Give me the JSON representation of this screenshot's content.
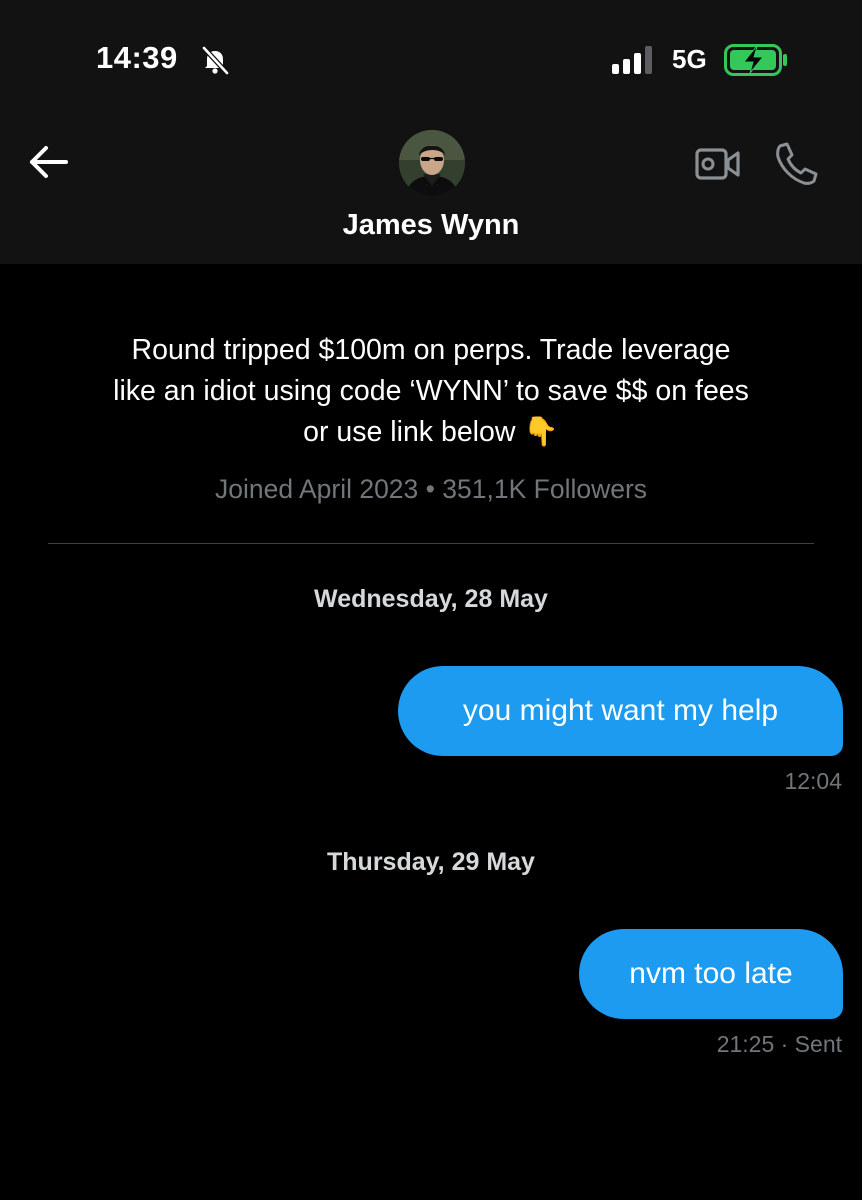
{
  "status_bar": {
    "time": "14:39",
    "network": "5G",
    "icons": [
      "bell-slash-icon",
      "signal-bars-icon",
      "battery-charging-icon"
    ]
  },
  "header": {
    "name": "James Wynn",
    "icons": [
      "back-arrow-icon",
      "video-camera-icon",
      "phone-icon"
    ]
  },
  "profile": {
    "bio_line1": "Round tripped $100m on perps. Trade leverage",
    "bio_line2": "like an idiot using code ‘WYNN’ to save $$ on fees",
    "bio_line3": "or use link below 👇",
    "meta": "Joined April 2023 • 351,1K Followers"
  },
  "messages": [
    {
      "date": "Wednesday, 28 May",
      "text": "you might want my help",
      "time": "12:04"
    },
    {
      "date": "Thursday, 29 May",
      "text": "nvm too late",
      "time": "21:25 · Sent"
    }
  ],
  "colors": {
    "bubble": "#1d9bf0",
    "header_bg": "#121212",
    "background": "#000000",
    "muted_text": "#71767b"
  }
}
